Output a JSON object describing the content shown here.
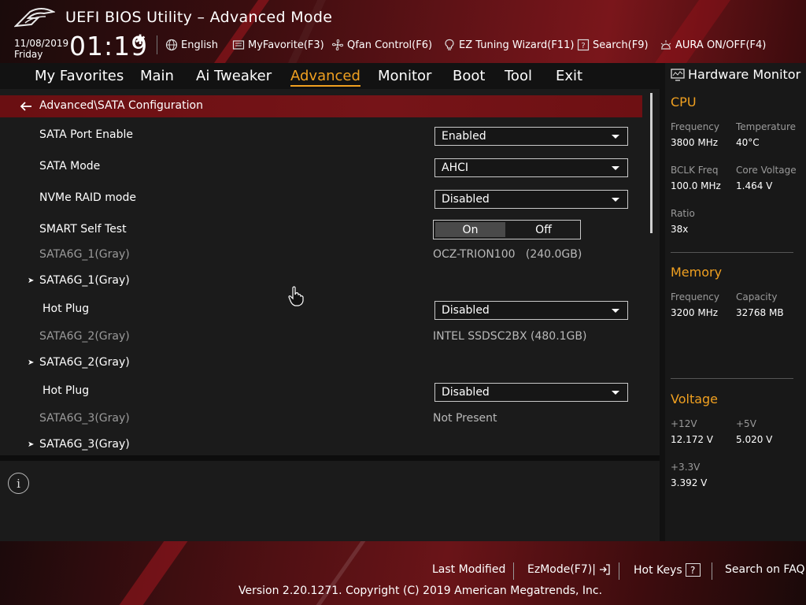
{
  "header": {
    "title": "UEFI BIOS Utility – Advanced Mode",
    "date": "11/08/2019",
    "weekday": "Friday",
    "time": "01:19",
    "toolbar": {
      "language": "English",
      "myfavorite": "MyFavorite(F3)",
      "qfan": "Qfan Control(F6)",
      "ez_tuning": "EZ Tuning Wizard(F11)",
      "search": "Search(F9)",
      "aura": "AURA ON/OFF(F4)"
    }
  },
  "nav": {
    "tabs": [
      "My Favorites",
      "Main",
      "Ai Tweaker",
      "Advanced",
      "Monitor",
      "Boot",
      "Tool",
      "Exit"
    ],
    "active": "Advanced"
  },
  "main": {
    "breadcrumb": "Advanced\\SATA Configuration",
    "rows": {
      "sata_port_enable": {
        "label": "SATA Port Enable",
        "value": "Enabled"
      },
      "sata_mode": {
        "label": "SATA Mode",
        "value": "AHCI"
      },
      "nvme_raid": {
        "label": "NVMe RAID mode",
        "value": "Disabled"
      },
      "smart": {
        "label": "SMART Self Test",
        "on": "On",
        "off": "Off",
        "selected": "On"
      },
      "sata1_info": {
        "label": "SATA6G_1(Gray)",
        "value": "OCZ-TRION100   (240.0GB)"
      },
      "sata1_expand": {
        "label": "SATA6G_1(Gray)"
      },
      "sata1_hotplug": {
        "label": "Hot Plug",
        "value": "Disabled"
      },
      "sata2_info": {
        "label": "SATA6G_2(Gray)",
        "value": "INTEL SSDSC2BX (480.1GB)"
      },
      "sata2_expand": {
        "label": "SATA6G_2(Gray)"
      },
      "sata2_hotplug": {
        "label": "Hot Plug",
        "value": "Disabled"
      },
      "sata3_info": {
        "label": "SATA6G_3(Gray)",
        "value": "Not Present"
      },
      "sata3_expand": {
        "label": "SATA6G_3(Gray)"
      }
    }
  },
  "info": {
    "icon": "i"
  },
  "hw": {
    "title": "Hardware Monitor",
    "cpu": {
      "heading": "CPU",
      "frequency_label": "Frequency",
      "frequency": "3800 MHz",
      "temperature_label": "Temperature",
      "temperature": "40°C",
      "bclk_label": "BCLK Freq",
      "bclk": "100.0 MHz",
      "core_voltage_label": "Core Voltage",
      "core_voltage": "1.464 V",
      "ratio_label": "Ratio",
      "ratio": "38x"
    },
    "memory": {
      "heading": "Memory",
      "frequency_label": "Frequency",
      "frequency": "3200 MHz",
      "capacity_label": "Capacity",
      "capacity": "32768 MB"
    },
    "voltage": {
      "heading": "Voltage",
      "v12_label": "+12V",
      "v12": "12.172 V",
      "v5_label": "+5V",
      "v5": "5.020 V",
      "v33_label": "+3.3V",
      "v33": "3.392 V"
    }
  },
  "footer": {
    "last_modified": "Last Modified",
    "ezmode": "EzMode(F7)|",
    "hot_keys": "Hot Keys",
    "hot_keys_box": "?",
    "search_faq": "Search on FAQ",
    "copyright": "Version 2.20.1271. Copyright (C) 2019 American Megatrends, Inc."
  },
  "colors": {
    "accent": "#f0a020",
    "breadcrumb": "#761418"
  }
}
